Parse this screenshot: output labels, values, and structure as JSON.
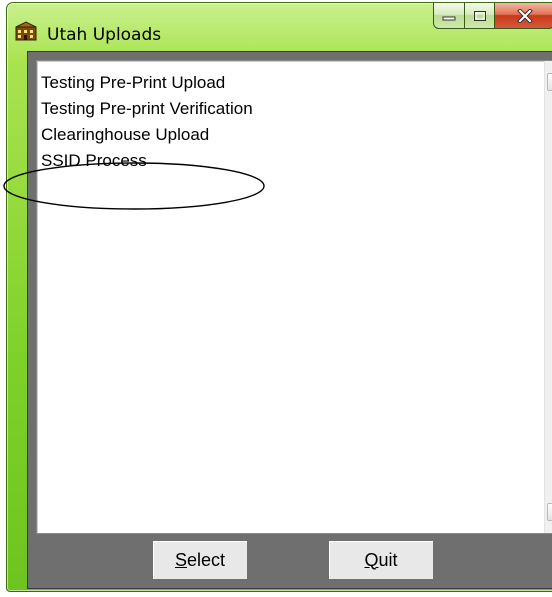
{
  "window": {
    "title": "Utah Uploads",
    "icon": "building-icon",
    "accent_color": "#7fd12a"
  },
  "caption_buttons": {
    "minimize_icon": "minimize-icon",
    "maximize_icon": "maximize-icon",
    "close_icon": "close-icon"
  },
  "list": {
    "items": [
      {
        "label": "Testing Pre-Print Upload"
      },
      {
        "label": "Testing Pre-print Verification"
      },
      {
        "label": "Clearinghouse Upload"
      },
      {
        "label": "SSID Process"
      }
    ]
  },
  "buttons": {
    "select": {
      "accel": "S",
      "rest": "elect"
    },
    "quit": {
      "accel": "Q",
      "rest": "uit"
    }
  }
}
